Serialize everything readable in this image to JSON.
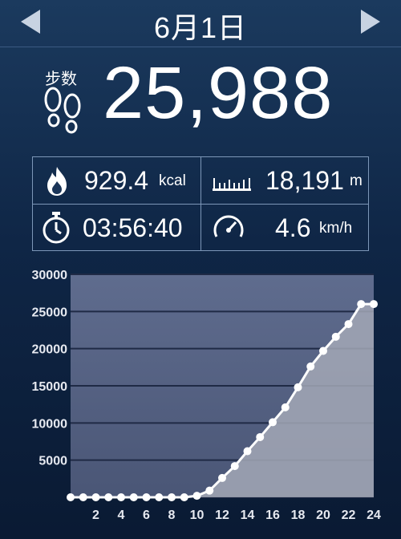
{
  "header": {
    "date": "6月1日"
  },
  "steps": {
    "label": "步数",
    "value": "25,988"
  },
  "stats": {
    "calories": {
      "value": "929.4",
      "unit": "kcal"
    },
    "distance": {
      "value": "18,191",
      "unit": "m"
    },
    "duration": {
      "value": "03:56:40"
    },
    "speed": {
      "value": "4.6",
      "unit": "km/h"
    }
  },
  "colors": {
    "line": "#ffffff",
    "plot_bg_top": "#5a6788",
    "plot_bg_bottom": "#4a5676",
    "area": "#a3a8b6"
  },
  "chart_data": {
    "type": "area",
    "x": [
      0,
      1,
      2,
      3,
      4,
      5,
      6,
      7,
      8,
      9,
      10,
      11,
      12,
      13,
      14,
      15,
      16,
      17,
      18,
      19,
      20,
      21,
      22,
      23,
      24
    ],
    "values": [
      0,
      0,
      0,
      0,
      0,
      0,
      0,
      0,
      0,
      0,
      200,
      900,
      2600,
      4200,
      6200,
      8100,
      10100,
      12100,
      14800,
      17600,
      19700,
      21600,
      23300,
      26000,
      26000
    ],
    "xticks": [
      "2",
      "4",
      "6",
      "8",
      "10",
      "12",
      "14",
      "16",
      "18",
      "20",
      "22",
      "24"
    ],
    "yticks": [
      "5000",
      "10000",
      "15000",
      "20000",
      "25000",
      "30000"
    ],
    "ylim": [
      0,
      30000
    ],
    "xlim": [
      0,
      24
    ]
  }
}
